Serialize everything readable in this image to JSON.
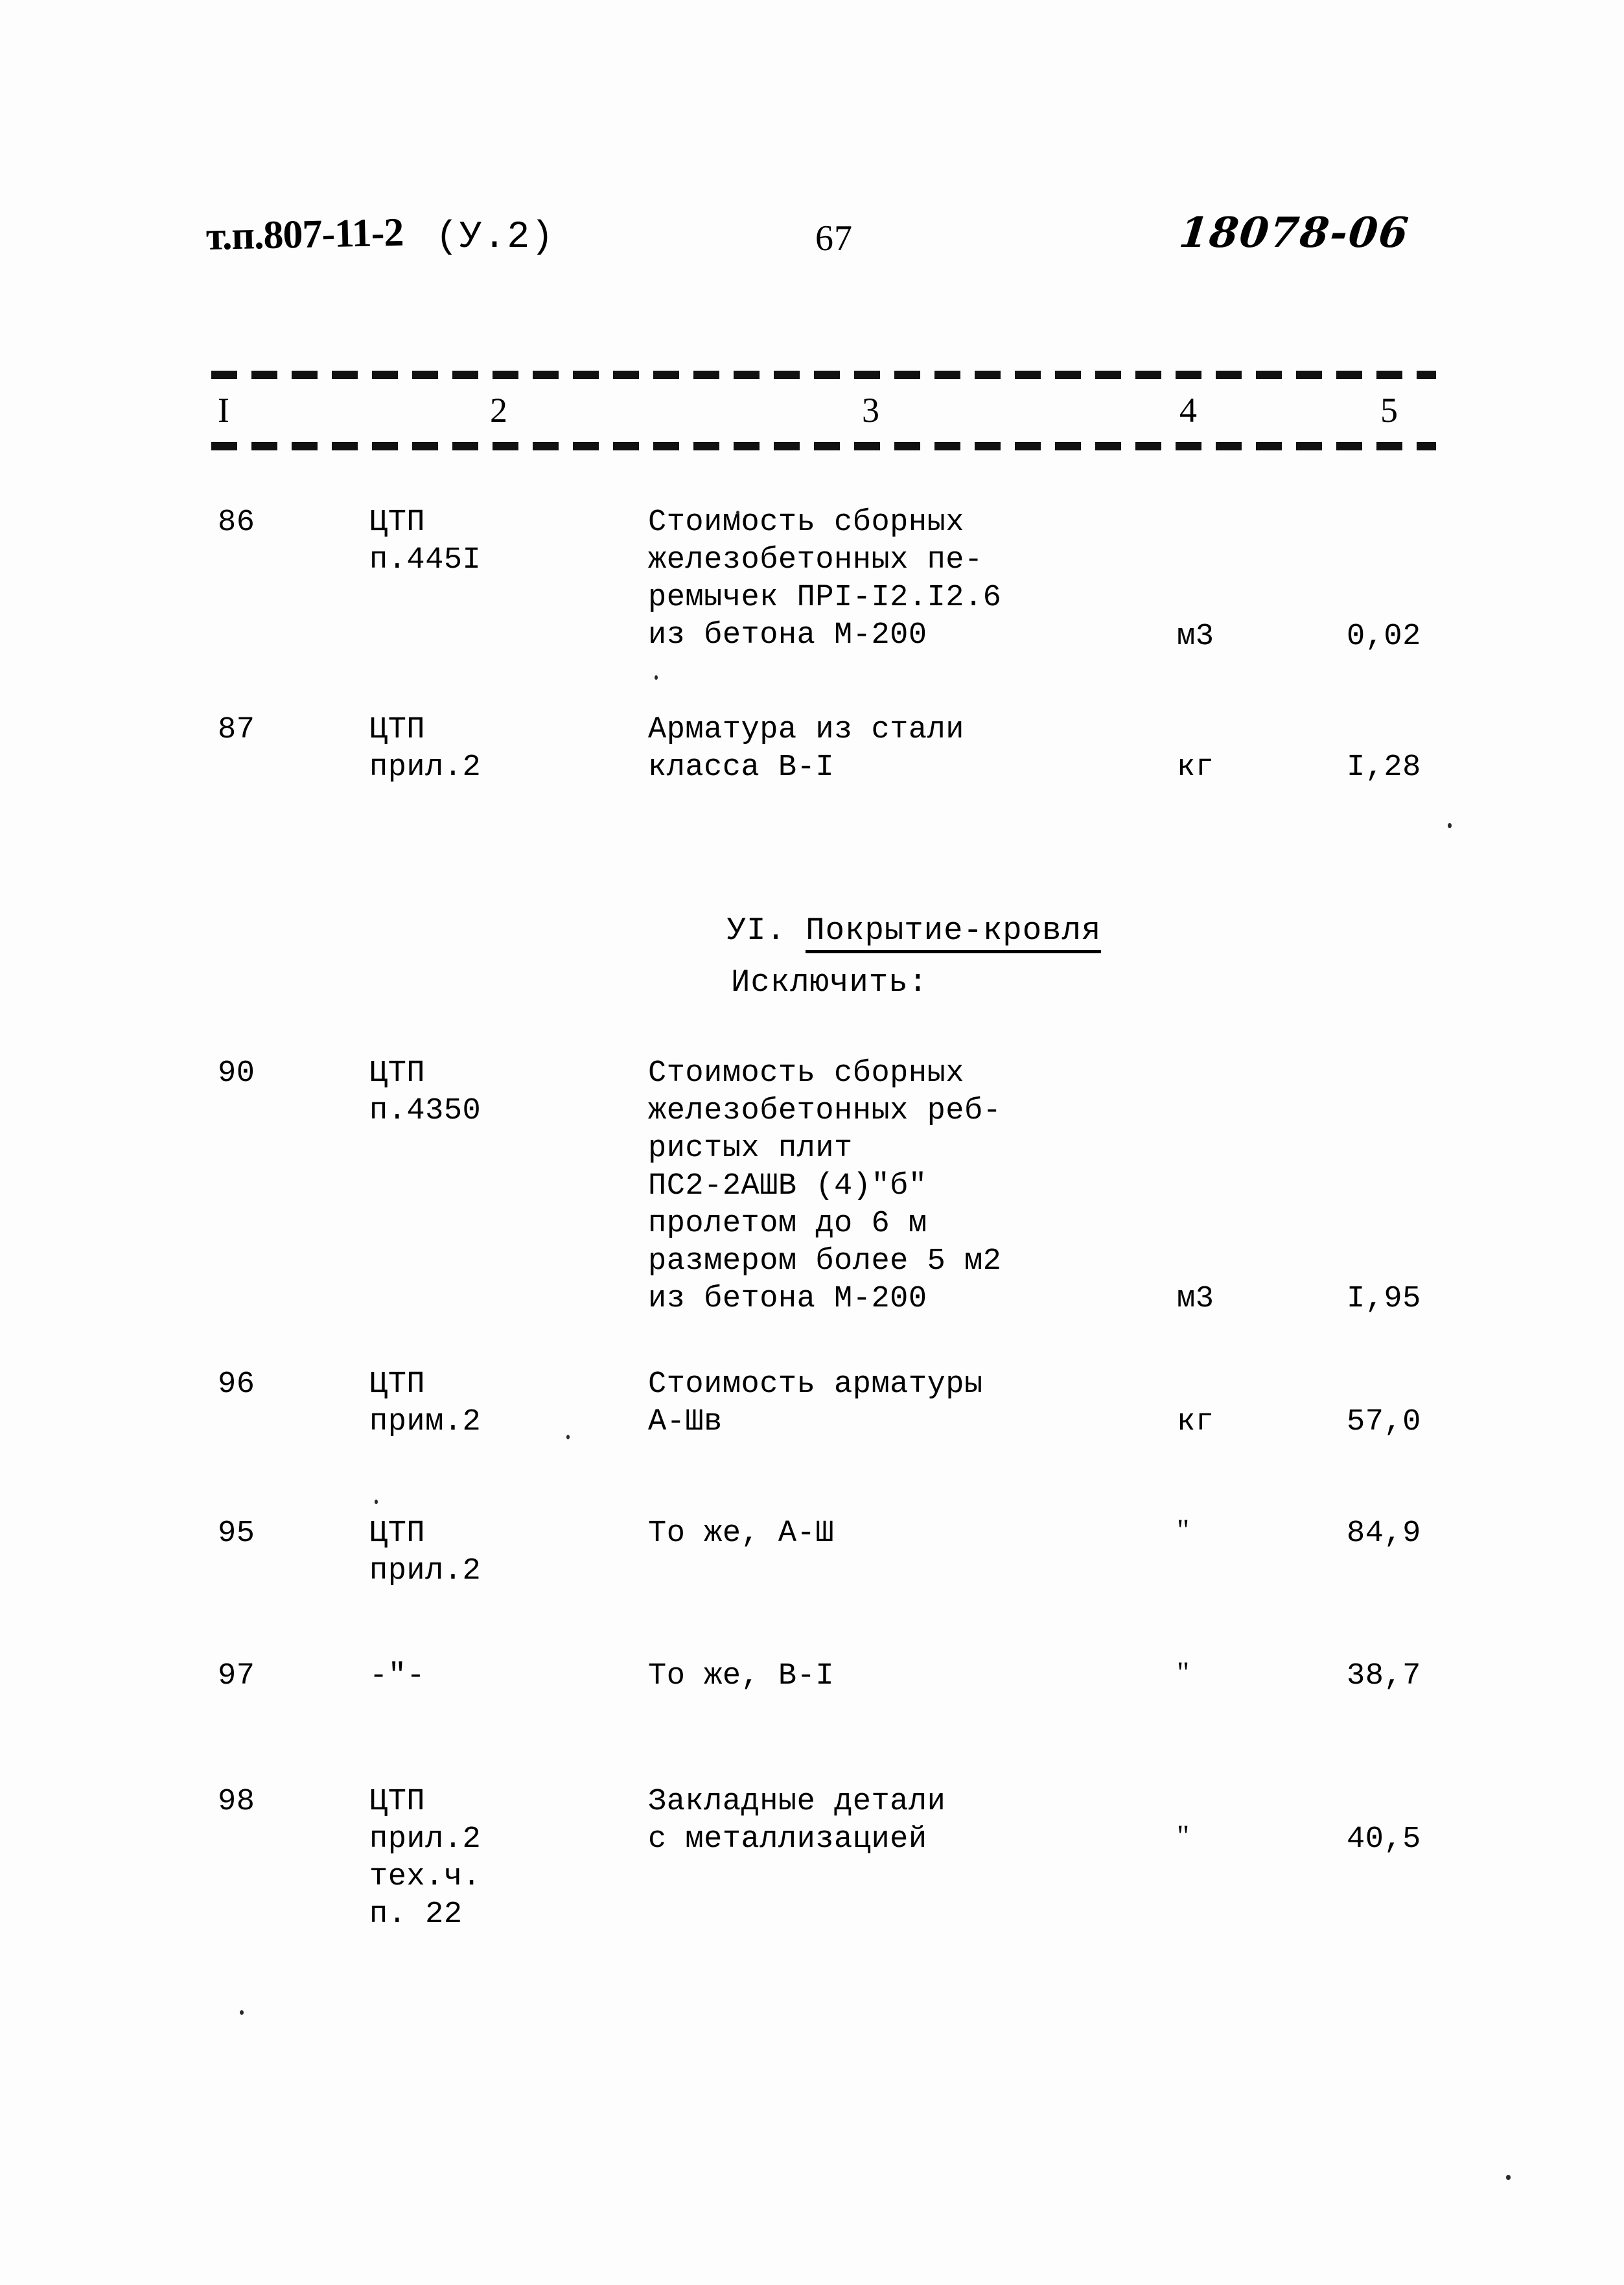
{
  "header": {
    "series_code": "т.п.807-11-2",
    "variant": "(У.2)",
    "page_number": "67",
    "archive_stamp": "18078-06"
  },
  "table": {
    "column_numbers": [
      "I",
      "2",
      "3",
      "4",
      "5"
    ],
    "rows": [
      {
        "num": "86",
        "ref": "ЦТП\nп.445I",
        "desc": "Стоимость сборных\nжелезобетонных пе-\nремычек ПРI-I2.I2.6\nиз бетона М-200",
        "unit": "м3",
        "qty": "0,02"
      },
      {
        "num": "87",
        "ref": "ЦТП\nприл.2",
        "desc": "Арматура из стали\nкласса В-I",
        "unit": "кг",
        "qty": "I,28"
      },
      {
        "num": "90",
        "ref": "ЦТП\nп.4350",
        "desc": "Стоимость сборных\nжелезобетонных реб-\nристых плит\nПС2-2АШВ (4)\"б\"\nпролетом до 6 м\nразмером более 5 м2\nиз бетона М-200",
        "unit": "м3",
        "qty": "I,95"
      },
      {
        "num": "96",
        "ref": "ЦТП\nприм.2",
        "desc": "Стоимость арматуры\nА-Шв",
        "unit": "кг",
        "qty": "57,0"
      },
      {
        "num": "95",
        "ref": "ЦТП\nприл.2",
        "desc": "То же, А-Ш",
        "unit": "\"",
        "qty": "84,9"
      },
      {
        "num": "97",
        "ref": "-\"-",
        "desc": "То же, В-I",
        "unit": "\"",
        "qty": "38,7"
      },
      {
        "num": "98",
        "ref": "ЦТП\nприл.2\nтех.ч.\nп. 22",
        "desc": "Закладные детали\nс металлизацией",
        "unit": "\"",
        "qty": "40,5"
      }
    ]
  },
  "section": {
    "number": "УI.",
    "title": "Покрытие-кровля",
    "instruction": "Исключить:"
  }
}
